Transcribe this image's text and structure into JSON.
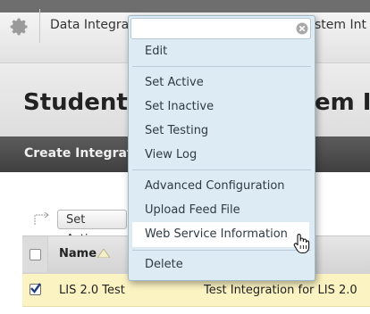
{
  "breadcrumb": {
    "label": "Data Integrati",
    "tail": "stem Int"
  },
  "page": {
    "title": "Student In",
    "title_tail": "em In"
  },
  "actionbar": {
    "create_label": "Create Integratio"
  },
  "toolbar": {
    "set_active_label": "Set Active"
  },
  "table": {
    "header": {
      "name": "Name"
    },
    "rows": [
      {
        "name": "LIS 2.0 Test",
        "description": "Test Integration for LIS 2.0",
        "checked": true
      }
    ]
  },
  "context_menu": {
    "search_value": "",
    "items": [
      {
        "label": "Edit"
      },
      {
        "label": "Set Active"
      },
      {
        "label": "Set Inactive"
      },
      {
        "label": "Set Testing"
      },
      {
        "label": "View Log"
      },
      {
        "label": "Advanced Configuration"
      },
      {
        "label": "Upload Feed File"
      },
      {
        "label": "Web Service Information"
      },
      {
        "label": "Delete"
      }
    ],
    "highlighted_item": "Web Service Information"
  },
  "icons": {
    "settings": "gear-icon",
    "clear": "clear-icon",
    "sort": "sort-ascending-icon",
    "cursor": "hand-pointer-icon"
  },
  "colors": {
    "menu_bg": "#dcebf4",
    "selected_row_bg": "#fbf3c2",
    "actionbar_bg": "#4a4a4a"
  }
}
